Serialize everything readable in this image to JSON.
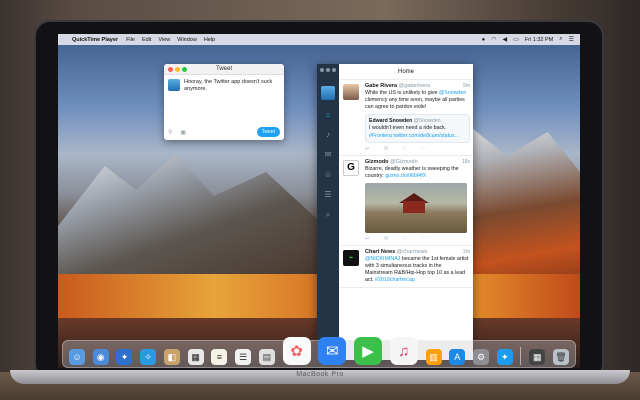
{
  "menubar": {
    "app_name": "QuickTime Player",
    "items": [
      "File",
      "Edit",
      "View",
      "Window",
      "Help"
    ],
    "clock": "Fri 1:32 PM"
  },
  "compose_window": {
    "title": "Tweet",
    "text": "Hooray, the Twitter app doesn't suck\nanymore.",
    "tweet_button": "Tweet"
  },
  "twitter": {
    "header": "Home",
    "tweets": [
      {
        "name": "Gabe Rivera",
        "handle": "@gaberivera",
        "time": "9m",
        "body_pre": "While the US is unlikely to give ",
        "body_link": "@Snowden",
        "body_post": " clemency any time soon, maybe all parties can agree to pardon exile!",
        "quote_name": "Edward Snowden",
        "quote_handle": "@Snowden",
        "quote_text": "I wouldn't even need a ride back.",
        "quote_link": "#Frontera twitter.com/de8cam/status..."
      },
      {
        "name": "Gizmodo",
        "handle": "@Gizmodo",
        "time": "18s",
        "body_pre": "Bizarre, deadly weather is sweeping the country: ",
        "body_link": "gizmo.do/iI6bf4fX",
        "body_post": ""
      },
      {
        "name": "Chart News",
        "handle": "@chartnews",
        "time": "2m",
        "body_pre": "",
        "body_link": "@NICKIMINAJ",
        "body_post": " became the 1st female artist with 3 simultaneous tracks in the Mainstream R&B/Hip-Hop top 10 as a lead act. ",
        "body_link2": "#2019chartrecap"
      }
    ]
  },
  "laptop_label": "MacBook Pro",
  "colors": {
    "twitter_blue": "#1da1f2",
    "sidebar": "#243447"
  }
}
